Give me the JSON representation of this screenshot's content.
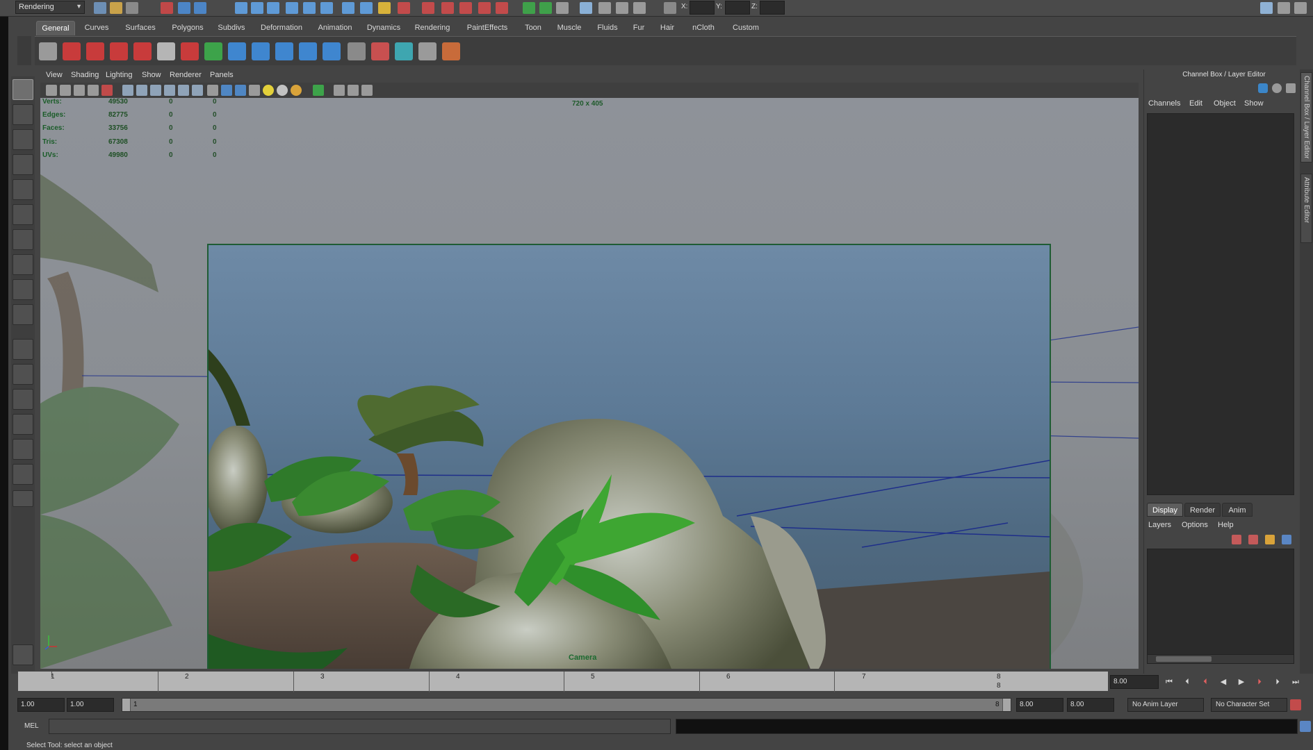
{
  "statusline": {
    "menu_set": "Rendering",
    "coord_x_label": "X:",
    "coord_y_label": "Y:",
    "coord_z_label": "Z:"
  },
  "shelf": {
    "tabs": [
      "General",
      "Curves",
      "Surfaces",
      "Polygons",
      "Subdivs",
      "Deformation",
      "Animation",
      "Dynamics",
      "Rendering",
      "PaintEffects",
      "Toon",
      "Muscle",
      "Fluids",
      "Fur",
      "Hair",
      "nCloth",
      "Custom"
    ],
    "active_tab": "General"
  },
  "panel": {
    "menus": [
      "View",
      "Shading",
      "Lighting",
      "Show",
      "Renderer",
      "Panels"
    ]
  },
  "hud": {
    "rows": [
      {
        "label": "Verts:",
        "value": "49530",
        "sel": "0",
        "comp": "0"
      },
      {
        "label": "Edges:",
        "value": "82775",
        "sel": "0",
        "comp": "0"
      },
      {
        "label": "Faces:",
        "value": "33756",
        "sel": "0",
        "comp": "0"
      },
      {
        "label": "Tris:",
        "value": "67308",
        "sel": "0",
        "comp": "0"
      },
      {
        "label": "UVs:",
        "value": "49980",
        "sel": "0",
        "comp": "0"
      }
    ],
    "resolution": "720 x 405",
    "camera": "Camera"
  },
  "channel_box": {
    "title": "Channel Box / Layer Editor",
    "menus": [
      "Channels",
      "Edit",
      "Object",
      "Show"
    ]
  },
  "layer_editor": {
    "tabs": [
      "Display",
      "Render",
      "Anim"
    ],
    "active_tab": "Display",
    "menus": [
      "Layers",
      "Options",
      "Help"
    ]
  },
  "side_tabs": [
    "Channel Box / Layer Editor",
    "Attribute Editor"
  ],
  "time_slider": {
    "ticks": [
      "1",
      "2",
      "3",
      "4",
      "5",
      "6",
      "7",
      "8"
    ],
    "current_frame_marker": "8",
    "current_frame": "8.00"
  },
  "range": {
    "start_time": "1.00",
    "playback_start": "1.00",
    "range_start_label": "1",
    "range_end_label": "8",
    "playback_end": "8.00",
    "end_time": "8.00",
    "anim_layer": "No Anim Layer",
    "character_set": "No Character Set"
  },
  "command_line": {
    "label": "MEL"
  },
  "help_line": "Select Tool: select an object",
  "colors": {
    "hud_green": "#1a5c28",
    "gate_border": "#1f5c34",
    "grid_blue": "#1e2e8a"
  }
}
